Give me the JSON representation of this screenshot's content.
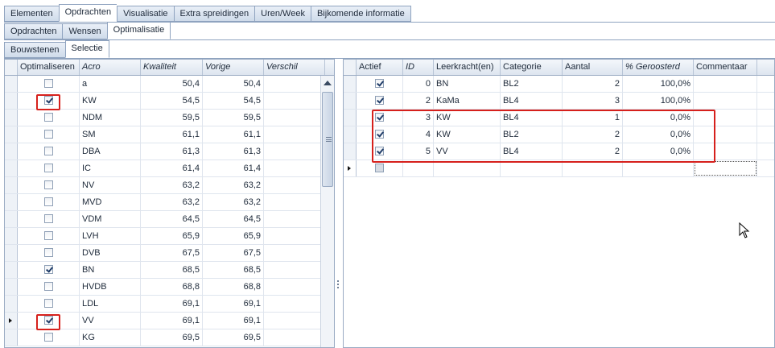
{
  "tabs_level1": [
    "Elementen",
    "Opdrachten",
    "Visualisatie",
    "Extra spreidingen",
    "Uren/Week",
    "Bijkomende informatie"
  ],
  "tabs_level1_active": "Opdrachten",
  "tabs_level2": [
    "Opdrachten",
    "Wensen",
    "Optimalisatie"
  ],
  "tabs_level2_active": "Optimalisatie",
  "tabs_level3": [
    "Bouwstenen",
    "Selectie"
  ],
  "tabs_level3_active": "Selectie",
  "left_grid": {
    "headers": [
      "Optimaliseren",
      "Acro",
      "Kwaliteit",
      "Vorige",
      "Verschil"
    ],
    "rows": [
      {
        "checked": false,
        "acro": "a",
        "kwaliteit": "50,4",
        "vorige": "50,4",
        "verschil": ""
      },
      {
        "checked": true,
        "acro": "KW",
        "kwaliteit": "54,5",
        "vorige": "54,5",
        "verschil": ""
      },
      {
        "checked": false,
        "acro": "NDM",
        "kwaliteit": "59,5",
        "vorige": "59,5",
        "verschil": ""
      },
      {
        "checked": false,
        "acro": "SM",
        "kwaliteit": "61,1",
        "vorige": "61,1",
        "verschil": ""
      },
      {
        "checked": false,
        "acro": "DBA",
        "kwaliteit": "61,3",
        "vorige": "61,3",
        "verschil": ""
      },
      {
        "checked": false,
        "acro": "IC",
        "kwaliteit": "61,4",
        "vorige": "61,4",
        "verschil": ""
      },
      {
        "checked": false,
        "acro": "NV",
        "kwaliteit": "63,2",
        "vorige": "63,2",
        "verschil": ""
      },
      {
        "checked": false,
        "acro": "MVD",
        "kwaliteit": "63,2",
        "vorige": "63,2",
        "verschil": ""
      },
      {
        "checked": false,
        "acro": "VDM",
        "kwaliteit": "64,5",
        "vorige": "64,5",
        "verschil": ""
      },
      {
        "checked": false,
        "acro": "LVH",
        "kwaliteit": "65,9",
        "vorige": "65,9",
        "verschil": ""
      },
      {
        "checked": false,
        "acro": "DVB",
        "kwaliteit": "67,5",
        "vorige": "67,5",
        "verschil": ""
      },
      {
        "checked": true,
        "acro": "BN",
        "kwaliteit": "68,5",
        "vorige": "68,5",
        "verschil": ""
      },
      {
        "checked": false,
        "acro": "HVDB",
        "kwaliteit": "68,8",
        "vorige": "68,8",
        "verschil": ""
      },
      {
        "checked": false,
        "acro": "LDL",
        "kwaliteit": "69,1",
        "vorige": "69,1",
        "verschil": ""
      },
      {
        "checked": true,
        "acro": "VV",
        "kwaliteit": "69,1",
        "vorige": "69,1",
        "verschil": "",
        "current": true
      },
      {
        "checked": false,
        "acro": "KG",
        "kwaliteit": "69,5",
        "vorige": "69,5",
        "verschil": ""
      }
    ]
  },
  "right_grid": {
    "headers": [
      "Actief",
      "ID",
      "Leerkracht(en)",
      "Categorie",
      "Aantal",
      "% Geroosterd",
      "Commentaar"
    ],
    "rows": [
      {
        "actief": true,
        "id": "0",
        "leerkracht": "BN",
        "categorie": "BL2",
        "aantal": "2",
        "pct": "100,0%",
        "commentaar": ""
      },
      {
        "actief": true,
        "id": "2",
        "leerkracht": "KaMa",
        "categorie": "BL4",
        "aantal": "3",
        "pct": "100,0%",
        "commentaar": ""
      },
      {
        "actief": true,
        "id": "3",
        "leerkracht": "KW",
        "categorie": "BL4",
        "aantal": "1",
        "pct": "0,0%",
        "commentaar": ""
      },
      {
        "actief": true,
        "id": "4",
        "leerkracht": "KW",
        "categorie": "BL2",
        "aantal": "2",
        "pct": "0,0%",
        "commentaar": ""
      },
      {
        "actief": true,
        "id": "5",
        "leerkracht": "VV",
        "categorie": "BL4",
        "aantal": "2",
        "pct": "0,0%",
        "commentaar": ""
      }
    ]
  }
}
